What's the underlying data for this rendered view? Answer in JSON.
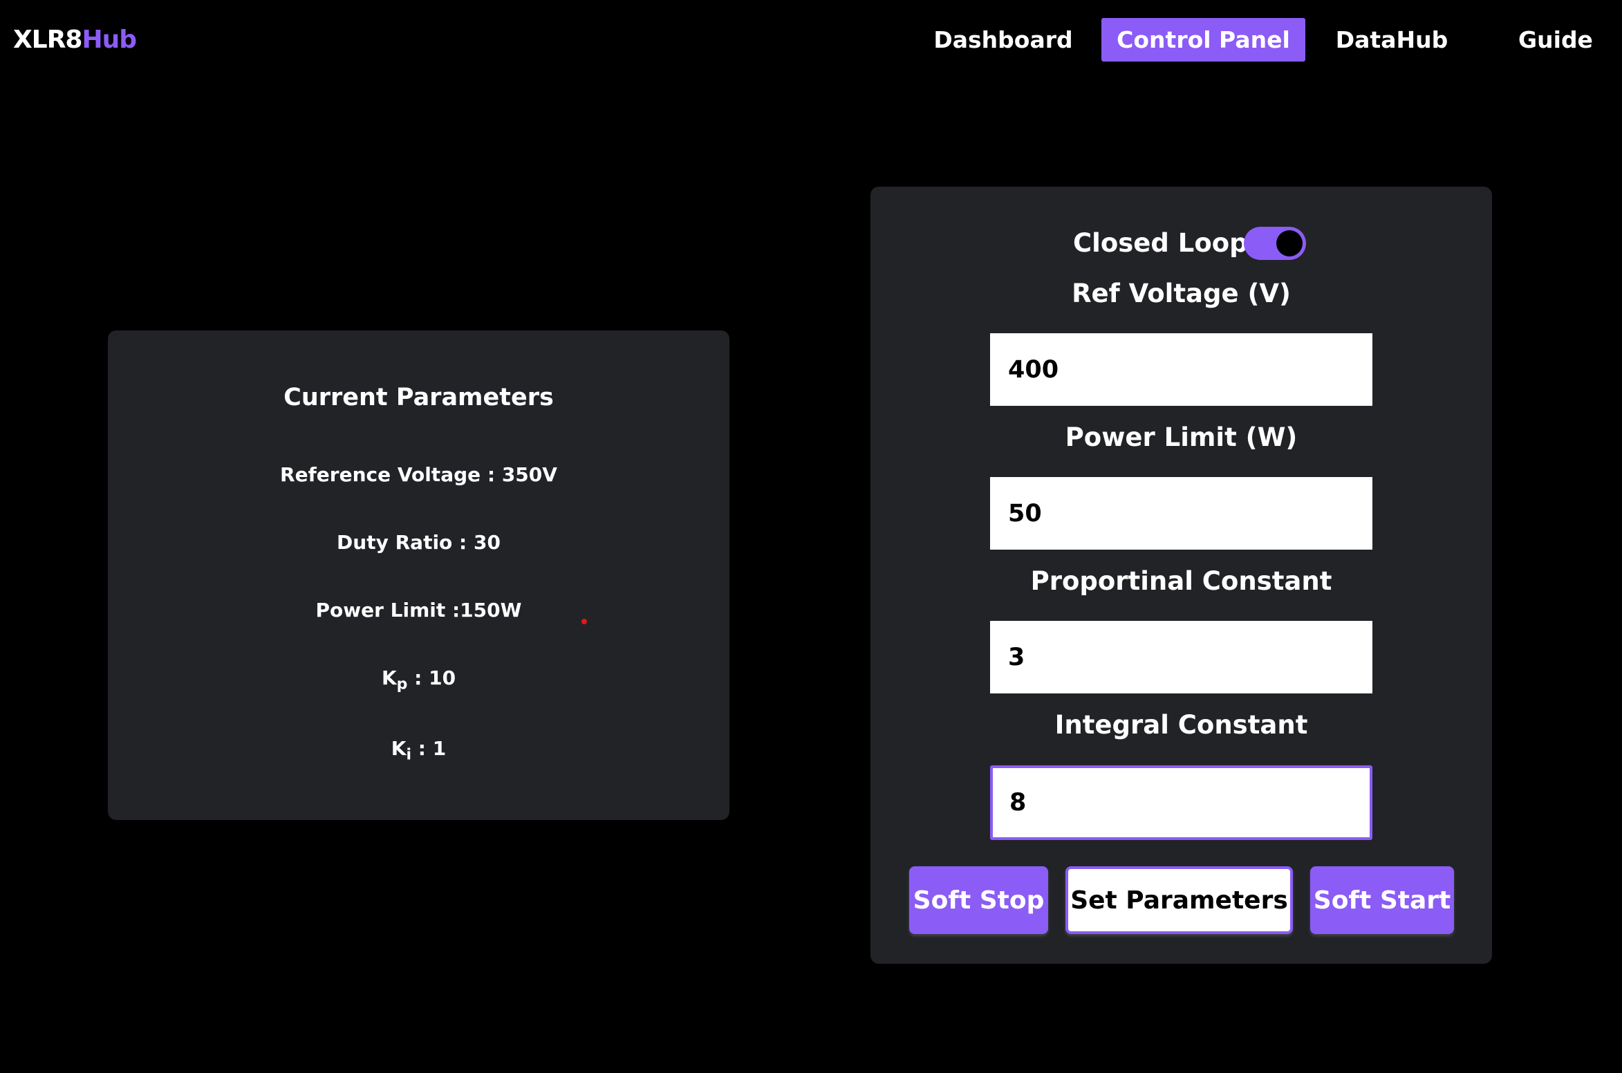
{
  "brand": {
    "name_part1": "XLR8",
    "name_part2": "Hub",
    "accent_color": "#8b5cf6"
  },
  "nav": {
    "items": [
      {
        "label": "Dashboard",
        "active": false
      },
      {
        "label": "Control Panel",
        "active": true
      },
      {
        "label": "DataHub",
        "active": false
      },
      {
        "label": "Guide",
        "active": false
      }
    ]
  },
  "current_parameters": {
    "title": "Current Parameters",
    "reference_voltage": "Reference Voltage : 350V",
    "duty_ratio": "Duty Ratio : 30",
    "power_limit": "Power Limit :150W",
    "kp_symbol": "K",
    "kp_sub": "p",
    "kp_value": " : 10",
    "ki_symbol": "K",
    "ki_sub": "i",
    "ki_value": " : 1"
  },
  "control": {
    "closed_loop_label": "Closed Loop",
    "closed_loop_on": true,
    "ref_voltage_label": "Ref Voltage (V)",
    "ref_voltage_value": "400",
    "power_limit_label": "Power Limit (W)",
    "power_limit_value": "50",
    "proportional_label": "Proportinal Constant",
    "proportional_value": "3",
    "integral_label": "Integral Constant",
    "integral_value": "8",
    "soft_stop_label": "Soft Stop",
    "set_parameters_label": "Set Parameters",
    "soft_start_label": "Soft Start"
  }
}
